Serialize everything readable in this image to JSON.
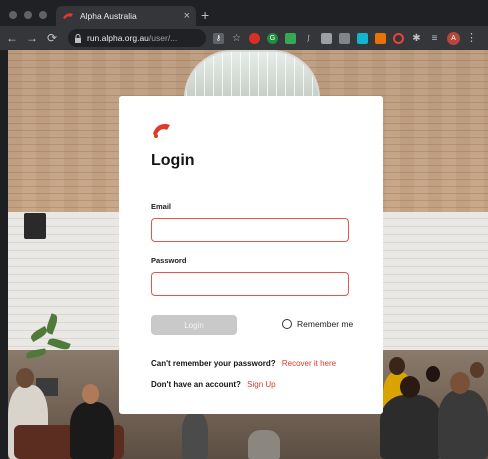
{
  "browser": {
    "tab_title": "Alpha Australia",
    "tab_close": "×",
    "new_tab": "+",
    "url_host": "run.alpha.org.au",
    "url_path": "/user/...",
    "back": "←",
    "forward": "→",
    "reload": "⟳",
    "profile_initial": "A",
    "menu": "⋮",
    "brand_color": "#e0392b"
  },
  "login": {
    "title": "Login",
    "email_label": "Email",
    "email_value": "",
    "password_label": "Password",
    "password_value": "",
    "submit_label": "Login",
    "remember_label": "Remember me",
    "forgot_question": "Can't remember your password?",
    "forgot_link": "Recover it here",
    "signup_question": "Don't have an account?",
    "signup_link": "Sign Up",
    "accent_color": "#e0392b",
    "input_border_color": "#e0574a"
  }
}
